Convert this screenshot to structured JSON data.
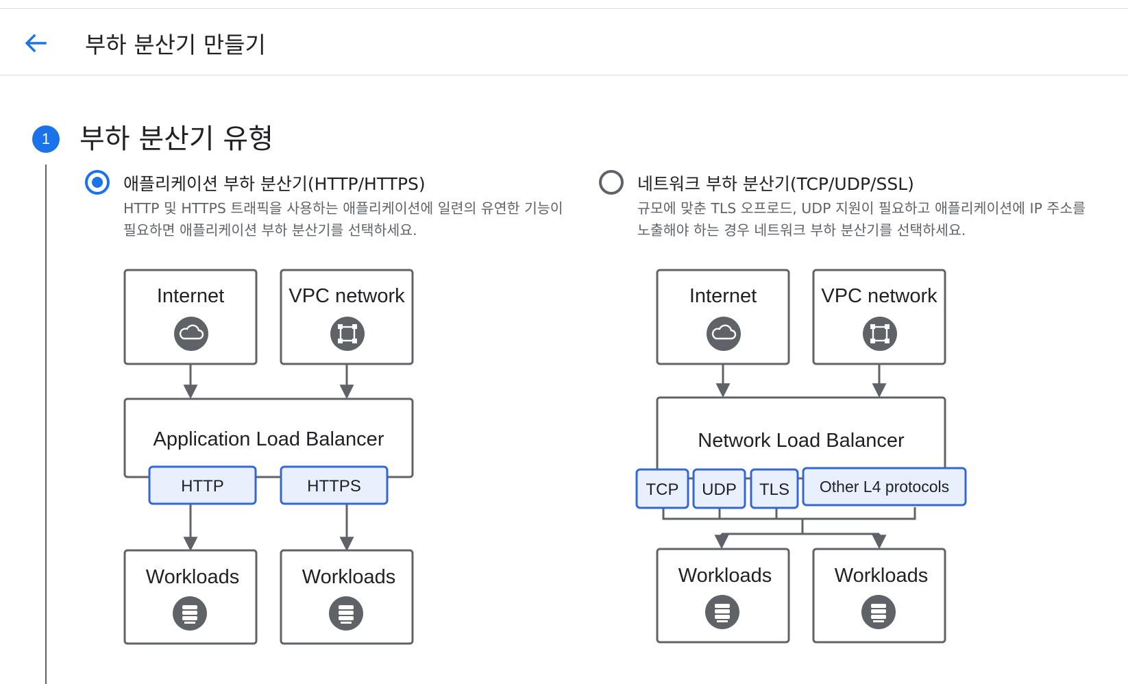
{
  "header": {
    "title": "부하 분산기 만들기"
  },
  "step": {
    "number": "1",
    "title": "부하 분산기 유형"
  },
  "options": [
    {
      "label": "애플리케이션 부하 분산기(HTTP/HTTPS)",
      "description": "HTTP 및 HTTPS 트래픽을 사용하는 애플리케이션에 일련의 유연한 기능이 필요하면 애플리케이션 부하 분산기를 선택하세요.",
      "selected": true,
      "diagram": {
        "sources": [
          "Internet",
          "VPC network"
        ],
        "balancer": "Application Load Balancer",
        "protocols": [
          "HTTP",
          "HTTPS"
        ],
        "targets": [
          "Workloads",
          "Workloads"
        ]
      }
    },
    {
      "label": "네트워크 부하 분산기(TCP/UDP/SSL)",
      "description": "규모에 맞춘 TLS 오프로드, UDP 지원이 필요하고 애플리케이션에 IP 주소를 노출해야 하는 경우 네트워크 부하 분산기를 선택하세요.",
      "selected": false,
      "diagram": {
        "sources": [
          "Internet",
          "VPC network"
        ],
        "balancer": "Network Load Balancer",
        "protocols": [
          "TCP",
          "UDP",
          "TLS",
          "Other L4 protocols"
        ],
        "targets": [
          "Workloads",
          "Workloads"
        ]
      }
    }
  ],
  "colors": {
    "accent": "#1a73e8",
    "box_border": "#5f6368",
    "protocol_fill": "#e8f0fe",
    "protocol_border": "#3367d6"
  },
  "icons": [
    "back-arrow-icon",
    "cloud-icon",
    "vpc-network-icon",
    "database-icon"
  ]
}
